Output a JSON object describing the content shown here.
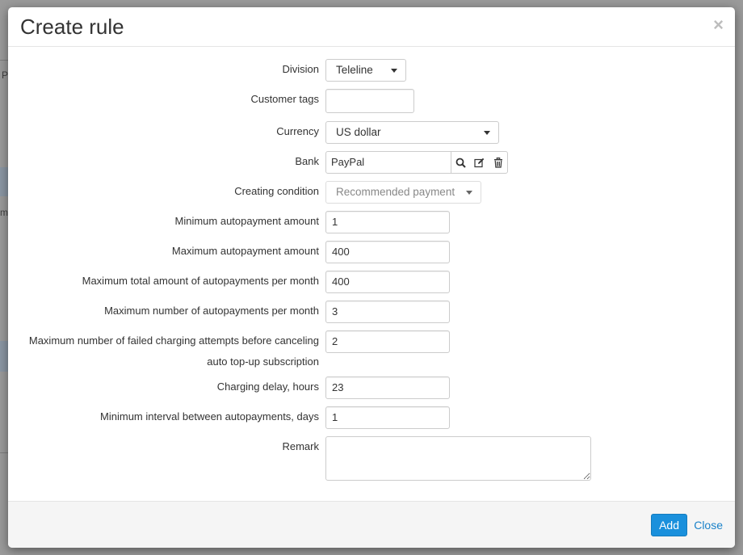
{
  "backdrop": {
    "letter_p": "P",
    "letter_m": "m"
  },
  "modal": {
    "title": "Create rule",
    "close_glyph": "×"
  },
  "form": {
    "division": {
      "label": "Division",
      "value": "Teleline"
    },
    "customer_tags": {
      "label": "Customer tags",
      "value": ""
    },
    "currency": {
      "label": "Currency",
      "value": "US dollar"
    },
    "bank": {
      "label": "Bank",
      "value": "PayPal",
      "icons": [
        "search-icon",
        "edit-icon",
        "trash-icon"
      ]
    },
    "creating_condition": {
      "label": "Creating condition",
      "value": "Recommended payment"
    },
    "min_autopayment": {
      "label": "Minimum autopayment amount",
      "value": "1"
    },
    "max_autopayment": {
      "label": "Maximum autopayment amount",
      "value": "400"
    },
    "max_total_per_month": {
      "label": "Maximum total amount of autopayments per month",
      "value": "400"
    },
    "max_number_per_month": {
      "label": "Maximum number of autopayments per month",
      "value": "3"
    },
    "max_failed_attempts": {
      "label": "Maximum number of failed charging attempts before canceling auto top-up subscription",
      "value": "2"
    },
    "charging_delay": {
      "label": "Charging delay, hours",
      "value": "23"
    },
    "min_interval": {
      "label": "Minimum interval between autopayments, days",
      "value": "1"
    },
    "remark": {
      "label": "Remark",
      "value": ""
    }
  },
  "footer": {
    "add_label": "Add",
    "close_label": "Close"
  },
  "colors": {
    "primary": "#1a90dc",
    "link": "#1a82c9"
  }
}
